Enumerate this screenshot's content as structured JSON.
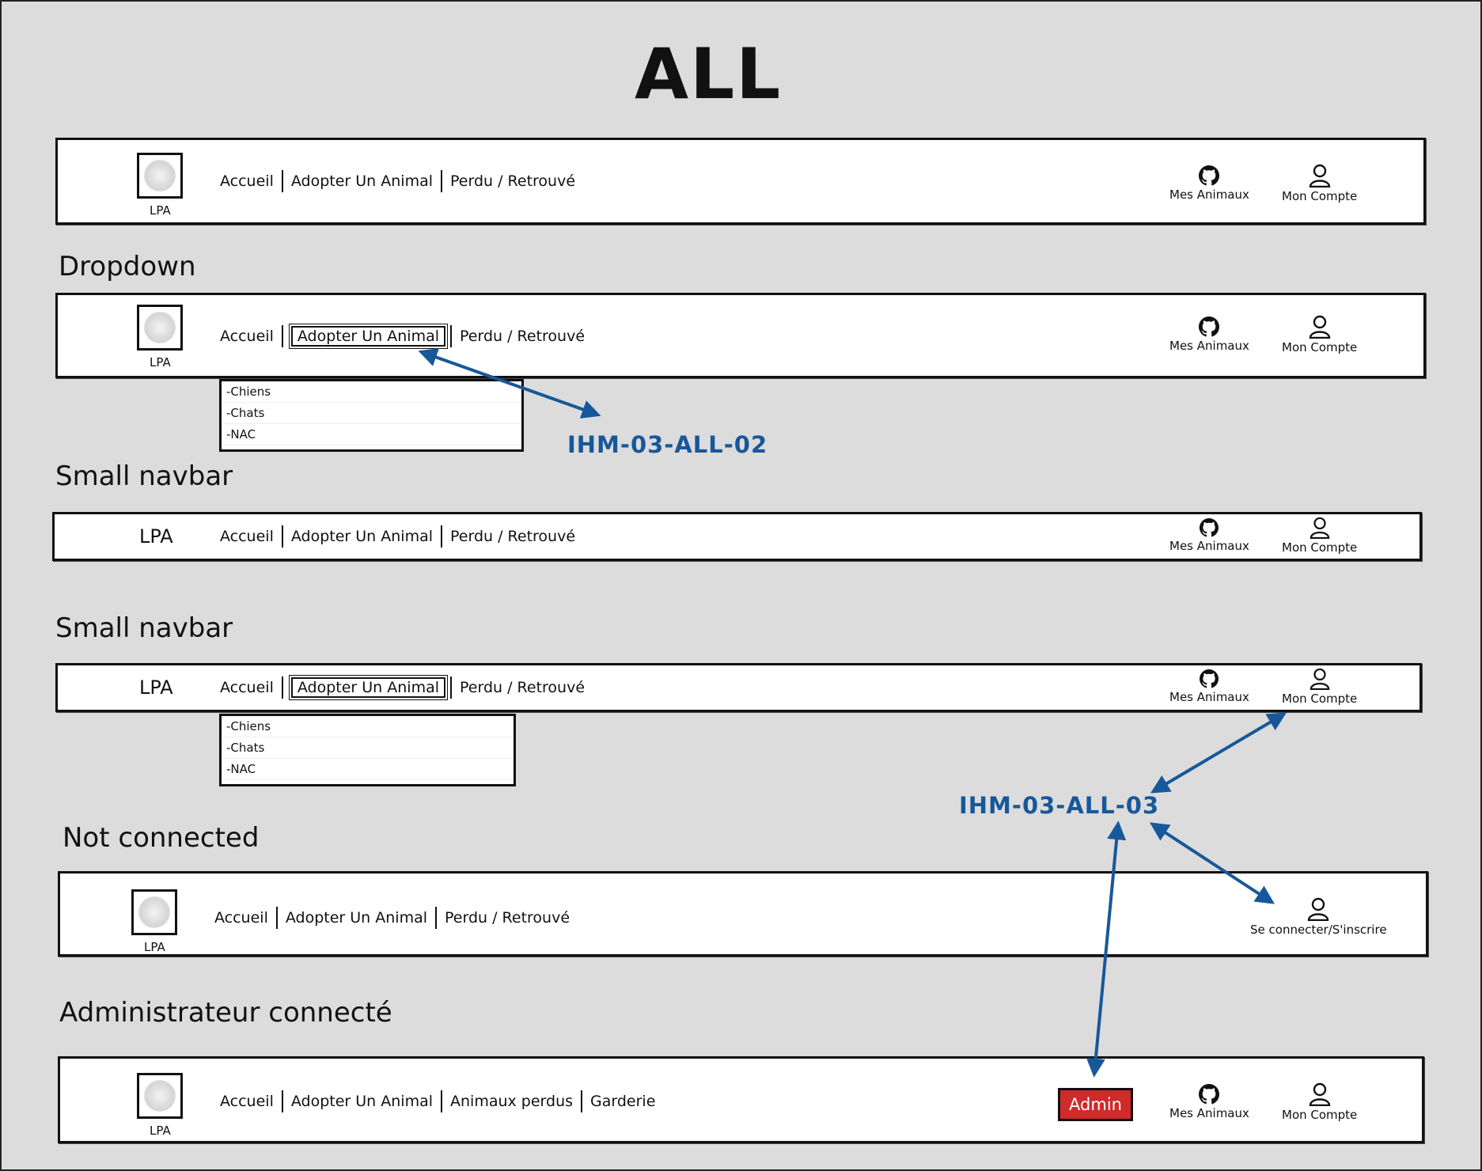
{
  "title": "ALL",
  "sections": {
    "dropdown": "Dropdown",
    "small_navbar_1": "Small navbar",
    "small_navbar_2": "Small navbar",
    "not_connected": "Not connected",
    "admin_connected": "Administrateur connecté"
  },
  "nav": {
    "brand": "LPA",
    "accueil": "Accueil",
    "adopter": "Adopter Un Animal",
    "perdu": "Perdu / Retrouvé",
    "animaux_perdus": "Animaux perdus",
    "garderie": "Garderie",
    "mes_animaux": "Mes Animaux",
    "mon_compte": "Mon Compte",
    "se_connecter": "Se connecter/S'inscrire",
    "admin": "Admin"
  },
  "dropdown_items": [
    "-Chiens",
    "-Chats",
    "-NAC"
  ],
  "annotations": {
    "ihm_02": "IHM-03-ALL-02",
    "ihm_03": "IHM-03-ALL-03"
  },
  "icons": {
    "mes_animaux": "github-icon",
    "mon_compte": "user-icon",
    "logo": "lpa-logo"
  },
  "colors": {
    "annotation": "#17589a",
    "admin_button": "#d02a2a",
    "background": "#dcdcdc"
  }
}
